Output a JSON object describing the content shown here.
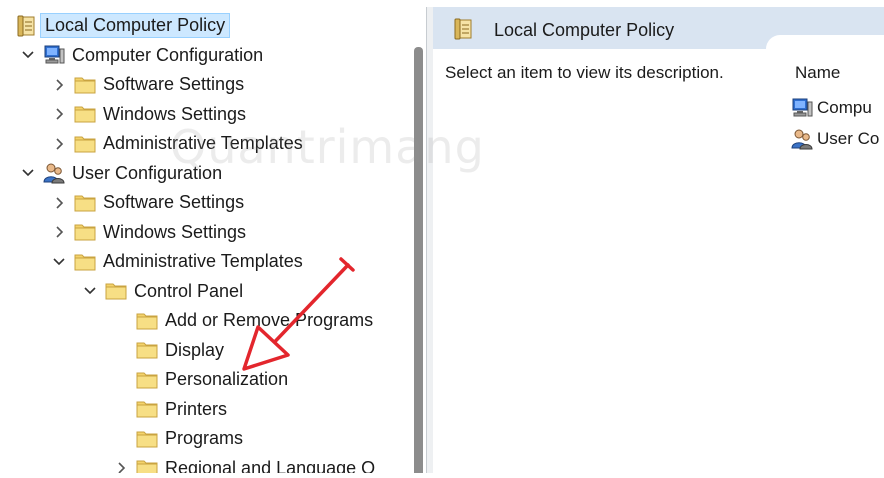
{
  "tree": {
    "root": {
      "label": "Local Computer Policy",
      "icon": "policy-document-icon",
      "selected": true
    },
    "nodes": [
      {
        "id": "computer-configuration",
        "label": "Computer Configuration",
        "icon": "computer-icon",
        "expander": "expanded",
        "level": 1
      },
      {
        "id": "cc-software-settings",
        "label": "Software Settings",
        "icon": "folder-icon",
        "expander": "collapsed",
        "level": 2
      },
      {
        "id": "cc-windows-settings",
        "label": "Windows Settings",
        "icon": "folder-icon",
        "expander": "collapsed",
        "level": 2
      },
      {
        "id": "cc-administrative-templates",
        "label": "Administrative Templates",
        "icon": "folder-icon",
        "expander": "collapsed",
        "level": 2
      },
      {
        "id": "user-configuration",
        "label": "User Configuration",
        "icon": "users-icon",
        "expander": "expanded",
        "level": 1
      },
      {
        "id": "uc-software-settings",
        "label": "Software Settings",
        "icon": "folder-icon",
        "expander": "collapsed",
        "level": 2
      },
      {
        "id": "uc-windows-settings",
        "label": "Windows Settings",
        "icon": "folder-icon",
        "expander": "collapsed",
        "level": 2
      },
      {
        "id": "uc-administrative-templates",
        "label": "Administrative Templates",
        "icon": "folder-icon",
        "expander": "expanded",
        "level": 2
      },
      {
        "id": "control-panel",
        "label": "Control Panel",
        "icon": "folder-icon",
        "expander": "expanded",
        "level": 3
      },
      {
        "id": "add-or-remove-programs",
        "label": "Add or Remove Programs",
        "icon": "folder-icon",
        "expander": "none",
        "level": 4
      },
      {
        "id": "display",
        "label": "Display",
        "icon": "folder-icon",
        "expander": "none",
        "level": 4
      },
      {
        "id": "personalization",
        "label": "Personalization",
        "icon": "folder-icon",
        "expander": "none",
        "level": 4
      },
      {
        "id": "printers",
        "label": "Printers",
        "icon": "folder-icon",
        "expander": "none",
        "level": 4
      },
      {
        "id": "programs",
        "label": "Programs",
        "icon": "folder-icon",
        "expander": "none",
        "level": 4
      },
      {
        "id": "regional-and-language",
        "label": "Regional and Language O",
        "icon": "folder-icon",
        "expander": "collapsed",
        "level": 4
      }
    ]
  },
  "right_pane": {
    "title": "Local Computer Policy",
    "title_icon": "policy-document-icon",
    "description": "Select an item to view its description.",
    "column_header": "Name",
    "items": [
      {
        "label": "Compu",
        "icon": "computer-icon"
      },
      {
        "label": "User Co",
        "icon": "users-icon"
      }
    ]
  },
  "annotation": {
    "type": "red-arrow",
    "target": "personalization",
    "color": "#e3262d"
  },
  "watermark": {
    "text": "Quantrimang"
  },
  "colors": {
    "selection_bg": "#cde8ff",
    "header_bg": "#d9e4f1",
    "folder_yellow": "#f4d36b",
    "arrow_red": "#e3262d"
  }
}
